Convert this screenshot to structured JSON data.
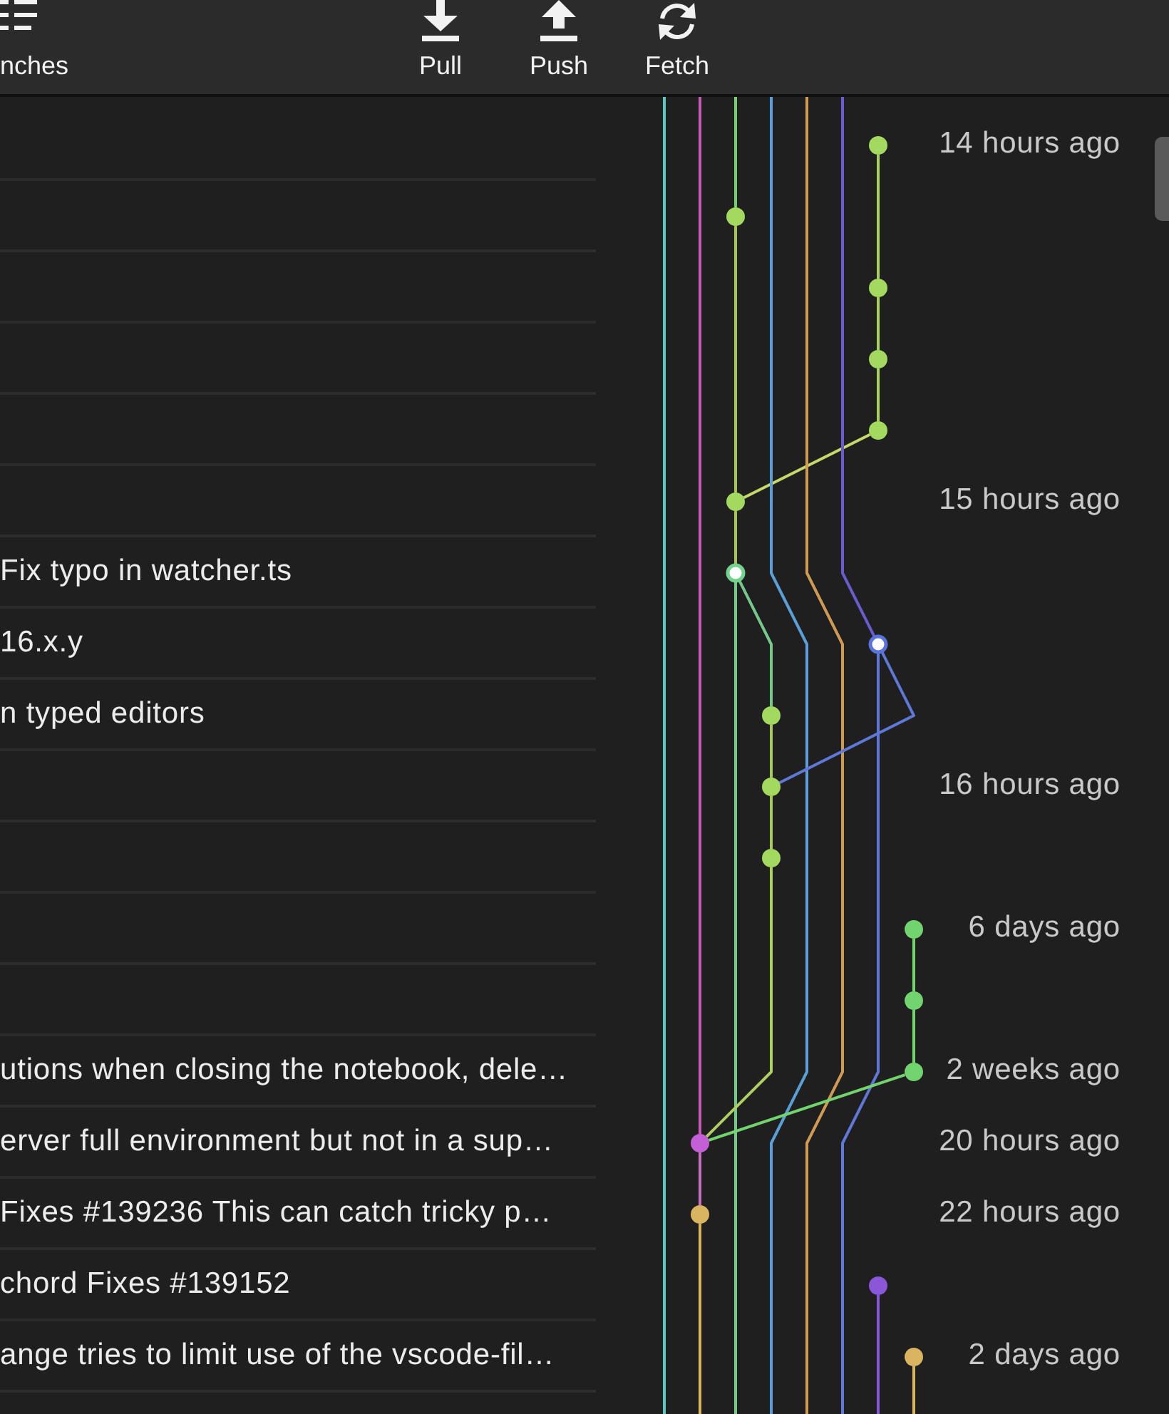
{
  "toolbar": {
    "branches_button": {
      "label": "nches"
    },
    "actions": [
      {
        "kind": "pull",
        "label": "Pull"
      },
      {
        "kind": "push",
        "label": "Push"
      },
      {
        "kind": "fetch",
        "label": "Fetch"
      }
    ]
  },
  "commits": [
    {
      "time": "14 hours ago",
      "node": {
        "color": "#a3d95f",
        "hollow": false
      }
    },
    {
      "node": {
        "color": "#a3d95f",
        "hollow": false
      }
    },
    {
      "node": {
        "color": "#a3d95f",
        "hollow": false
      }
    },
    {
      "node": {
        "color": "#a3d95f",
        "hollow": false
      }
    },
    {
      "node": {
        "color": "#a3d95f",
        "hollow": false
      }
    },
    {
      "time": "15 hours ago",
      "node": {
        "color": "#a3d95f",
        "hollow": false
      }
    },
    {
      "message": "Fix typo in watcher.ts",
      "node": {
        "color": "#72d48c",
        "hollow": true
      }
    },
    {
      "message": "16.x.y",
      "node": {
        "color": "#5a72dc",
        "hollow": true
      }
    },
    {
      "message": "n typed editors",
      "node": {
        "color": "#a3d95f",
        "hollow": false
      }
    },
    {
      "time": "16 hours ago",
      "node": {
        "color": "#a3d95f",
        "hollow": false
      }
    },
    {
      "node": {
        "color": "#a3d95f",
        "hollow": false
      }
    },
    {
      "time": "6 days ago",
      "node": {
        "color": "#72d46e",
        "hollow": false
      }
    },
    {
      "node": {
        "color": "#72d46e",
        "hollow": false
      }
    },
    {
      "message": "utions when closing the notebook, dele…",
      "time": "2 weeks ago",
      "node": {
        "color": "#72d46e",
        "hollow": false
      }
    },
    {
      "message": "erver full environment but not in a sup…",
      "time": "20 hours ago",
      "node": {
        "color": "#c55fd6",
        "hollow": false
      }
    },
    {
      "message": "Fixes #139236 This can catch tricky p…",
      "time": "22 hours ago",
      "node": {
        "color": "#d9b562",
        "hollow": false
      }
    },
    {
      "message": "chord Fixes #139152",
      "node": {
        "color": "#8b57d9",
        "hollow": false
      }
    },
    {
      "message": "ange tries to limit use of the vscode-fil…",
      "time": "2 days ago",
      "node": {
        "color": "#d9b562",
        "hollow": false
      }
    }
  ]
}
